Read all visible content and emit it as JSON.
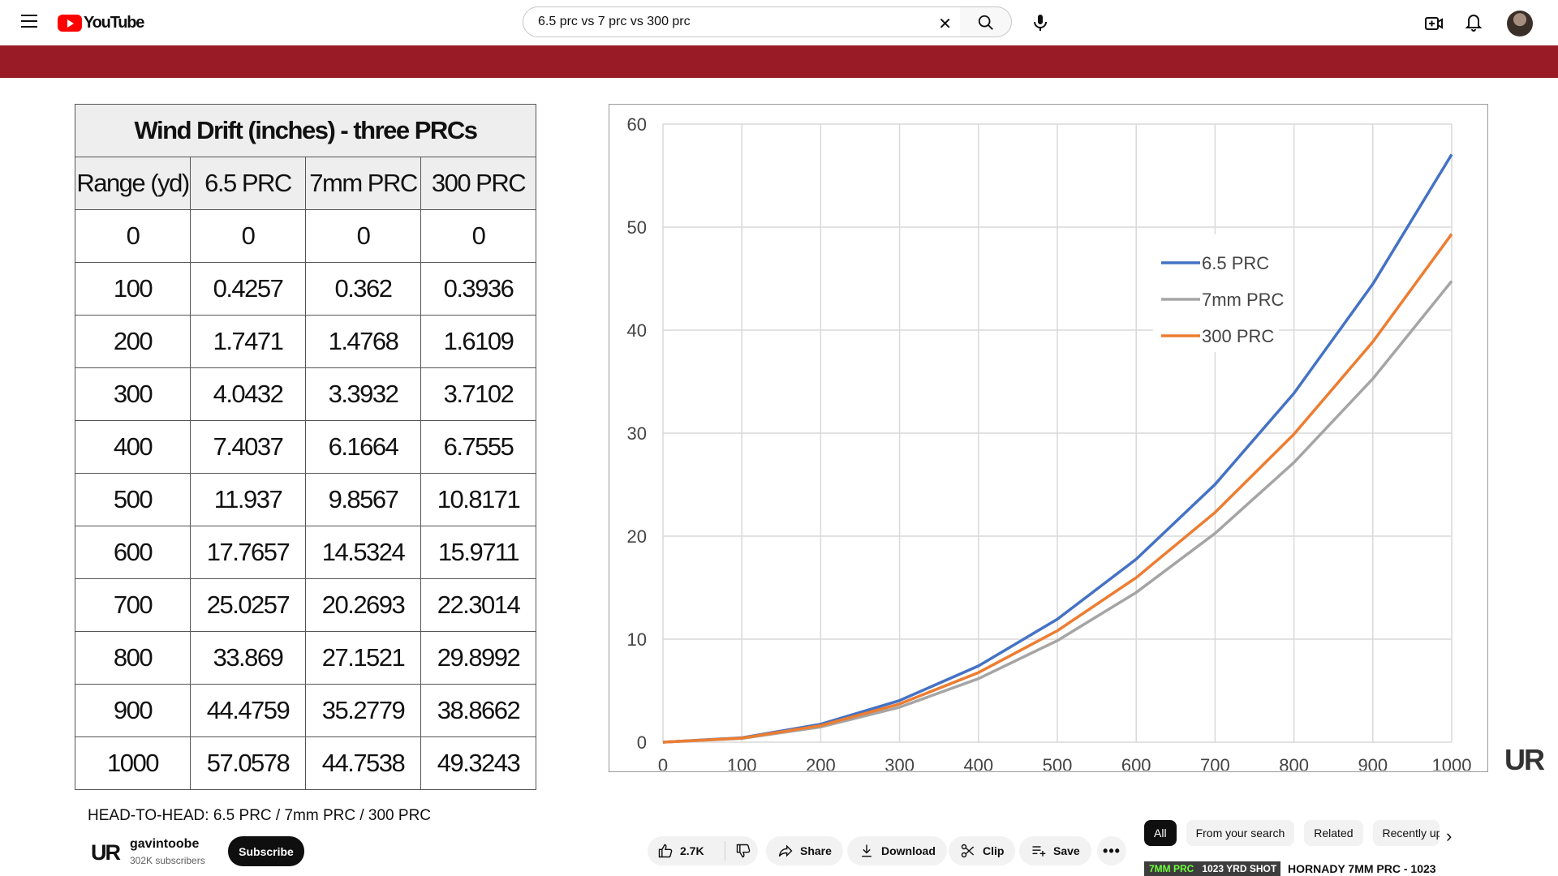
{
  "header": {
    "logo_text": "YouTube",
    "search_value": "6.5 prc vs 7 prc vs 300 prc"
  },
  "video_frame": {
    "table": {
      "title": "Wind Drift (inches) - three PRCs",
      "columns": [
        "Range (yd)",
        "6.5 PRC",
        "7mm PRC",
        "300 PRC"
      ],
      "rows": [
        [
          "0",
          "0",
          "0",
          "0"
        ],
        [
          "100",
          "0.4257",
          "0.362",
          "0.3936"
        ],
        [
          "200",
          "1.7471",
          "1.4768",
          "1.6109"
        ],
        [
          "300",
          "4.0432",
          "3.3932",
          "3.7102"
        ],
        [
          "400",
          "7.4037",
          "6.1664",
          "6.7555"
        ],
        [
          "500",
          "11.937",
          "9.8567",
          "10.8171"
        ],
        [
          "600",
          "17.7657",
          "14.5324",
          "15.9711"
        ],
        [
          "700",
          "25.0257",
          "20.2693",
          "22.3014"
        ],
        [
          "800",
          "33.869",
          "27.1521",
          "29.8992"
        ],
        [
          "900",
          "44.4759",
          "35.2779",
          "38.8662"
        ],
        [
          "1000",
          "57.0578",
          "44.7538",
          "49.3243"
        ]
      ]
    },
    "watermark": "UR"
  },
  "chart_data": {
    "type": "line",
    "x": [
      0,
      100,
      200,
      300,
      400,
      500,
      600,
      700,
      800,
      900,
      1000
    ],
    "series": [
      {
        "name": "6.5 PRC",
        "color": "#4472c4",
        "values": [
          0,
          0.4257,
          1.7471,
          4.0432,
          7.4037,
          11.937,
          17.7657,
          25.0257,
          33.869,
          44.4759,
          57.0578
        ]
      },
      {
        "name": "7mm PRC",
        "color": "#a5a5a5",
        "values": [
          0,
          0.362,
          1.4768,
          3.3932,
          6.1664,
          9.8567,
          14.5324,
          20.2693,
          27.1521,
          35.2779,
          44.7538
        ]
      },
      {
        "name": "300 PRC",
        "color": "#ed7d31",
        "values": [
          0,
          0.3936,
          1.6109,
          3.7102,
          6.7555,
          10.8171,
          15.9711,
          22.3014,
          29.8992,
          38.8662,
          49.3243
        ]
      }
    ],
    "xticks": [
      "0",
      "100",
      "200",
      "300",
      "400",
      "500",
      "600",
      "700",
      "800",
      "900",
      "1000"
    ],
    "yticks": [
      "0",
      "10",
      "20",
      "30",
      "40",
      "50",
      "60"
    ],
    "xlim": [
      0,
      1000
    ],
    "ylim": [
      0,
      60
    ],
    "grid": true,
    "legend_position": "upper-middle-right"
  },
  "below": {
    "video_title": "HEAD-TO-HEAD: 6.5 PRC / 7mm PRC / 300 PRC",
    "channel_logo": "UR",
    "channel_name": "gavintoobe",
    "subscribers": "302K subscribers",
    "subscribe_label": "Subscribe",
    "like_count": "2.7K",
    "share_label": "Share",
    "download_label": "Download",
    "clip_label": "Clip",
    "save_label": "Save",
    "chips": [
      "All",
      "From your search",
      "Related",
      "Recently up"
    ],
    "rec_thumb_text": "7MM PRC",
    "rec_thumb_text2": "1023 YRD SHOT",
    "rec_title": "HORNADY 7MM PRC - 1023"
  }
}
